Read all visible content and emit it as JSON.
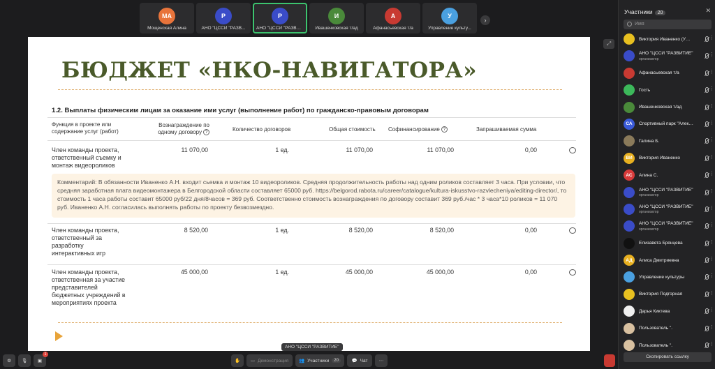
{
  "strip": {
    "tiles": [
      {
        "name": "Мощенская Алина",
        "avatar": "МА",
        "color": "#e8743b",
        "active": false
      },
      {
        "name": "АНО \"ЦССИ \"РАЗВ...",
        "avatar": "Р",
        "color": "#3a4cc8",
        "active": false
      },
      {
        "name": "АНО \"ЦССИ \"РАЗВИТ...",
        "avatar": "Р",
        "color": "#3a4cc8",
        "active": true
      },
      {
        "name": "Ивашенковская т/ад",
        "avatar": "И",
        "color": "#4a8a3a",
        "active": false
      },
      {
        "name": "Афанасьевская т/а",
        "avatar": "А",
        "color": "#c83a32",
        "active": false
      },
      {
        "name": "Управление культу...",
        "avatar": "У",
        "color": "#4aa0e0",
        "active": false
      }
    ]
  },
  "slide": {
    "title": "БЮДЖЕТ «НКО-НАВИГАТОРА»",
    "section": "1.2. Выплаты физическим лицам за оказание ими услуг (выполнение работ) по гражданско-правовым договорам",
    "headers": {
      "function": "Функция в проекте или содержание услуг (работ)",
      "fee": "Вознаграждение по одному договору",
      "count": "Количество договоров",
      "total": "Общая стоимость",
      "cofin": "Софинансирование",
      "requested": "Запрашиваемая сумма"
    },
    "rows": [
      {
        "function": "Член команды проекта, ответственный съемку и монтаж видеороликов",
        "fee": "11 070,00",
        "count": "1 ед.",
        "total": "11 070,00",
        "cofin": "11 070,00",
        "requested": "0,00"
      },
      {
        "function": "Член команды проекта, ответственный за разработку интерактивных игр",
        "fee": "8 520,00",
        "count": "1 ед.",
        "total": "8 520,00",
        "cofin": "8 520,00",
        "requested": "0,00"
      },
      {
        "function": "Член команды проекта, ответственная за участие представителей бюджетных учреждений в мероприятиях проекта",
        "fee": "45 000,00",
        "count": "1 ед.",
        "total": "45 000,00",
        "cofin": "45 000,00",
        "requested": "0,00"
      }
    ],
    "comment": "Комментарий: В обязанности Иваненко А.Н. входит сьемка и монтаж 10 видеороликов. Средняя продолжительность работы над одним роликов составляет 3 часа. При условии, что средняя заработная плата видеомонтажера в Белгородской области составляет 65000 руб. https://belgorod.rabota.ru/career/catalogue/kultura-iskusstvo-razvlecheniya/editing-director/, то стоимость 1 часа работы составит 65000 руб/22 дня/8часов = 369 руб. Соответственно стоимость вознаграждения по договору составит 369 руб./час * 3 часа*10 роликов = 11 070 руб. Иваненко А.Н. согласилась выполнять работы по проекту безвозмездно."
  },
  "speaker_tag": "АНО \"ЦССИ \"РАЗВИТИЕ\"",
  "panel": {
    "title": "Участники",
    "count": "20",
    "search_placeholder": "Имя",
    "copy_link": "Скопировать ссылку",
    "participants": [
      {
        "name": "Виктория Иваненко (УФКС...",
        "role": "",
        "avatar": "",
        "color": "#e8c020"
      },
      {
        "name": "АНО \"ЦССИ \"РАЗВИТИЕ\"",
        "role": "организатор",
        "avatar": "",
        "color": "#3a4cc8"
      },
      {
        "name": "Афанасьевская т/а",
        "role": "",
        "avatar": "",
        "color": "#c83a32"
      },
      {
        "name": "Гость",
        "role": "",
        "avatar": "",
        "color": "#3cb85a"
      },
      {
        "name": "Ивашенковская т/ад",
        "role": "",
        "avatar": "",
        "color": "#4a8a3a"
      },
      {
        "name": "Спортивный парк \"Алексее...",
        "role": "",
        "avatar": "СА",
        "color": "#3a5ad8"
      },
      {
        "name": "Галина Б.",
        "role": "",
        "avatar": "",
        "color": "#8a7a5a"
      },
      {
        "name": "Виктория Иваненко",
        "role": "",
        "avatar": "ВИ",
        "color": "#e8b020"
      },
      {
        "name": "Алина С.",
        "role": "",
        "avatar": "АС",
        "color": "#d83a3a"
      },
      {
        "name": "АНО \"ЦССИ \"РАЗВИТИЕ\"",
        "role": "организатор",
        "avatar": "",
        "color": "#3a4cc8"
      },
      {
        "name": "АНО \"ЦССИ \"РАЗВИТИЕ\"",
        "role": "организатор",
        "avatar": "",
        "color": "#3a4cc8"
      },
      {
        "name": "АНО \"ЦССИ \"РАЗВИТИЕ\"",
        "role": "организатор",
        "avatar": "",
        "color": "#3a4cc8"
      },
      {
        "name": "Елизавета Брянцева",
        "role": "",
        "avatar": "",
        "color": "#111111"
      },
      {
        "name": "Алиса Дмитриевна",
        "role": "",
        "avatar": "АД",
        "color": "#e8b020"
      },
      {
        "name": "Управление культуры",
        "role": "",
        "avatar": "",
        "color": "#4aa0e0"
      },
      {
        "name": "Виктория Подгорная",
        "role": "",
        "avatar": "",
        "color": "#e8c020"
      },
      {
        "name": "Дарья Киктева",
        "role": "",
        "avatar": "",
        "color": "#f0f0f0"
      },
      {
        "name": "Пользователь \".",
        "role": "",
        "avatar": "",
        "color": "#d8c0a0"
      },
      {
        "name": "Пользователь \".",
        "role": "",
        "avatar": "",
        "color": "#d8c0a0"
      }
    ]
  },
  "bottom": {
    "demo_label": "Демонстрация",
    "participants_label": "Участники",
    "participants_count": "20",
    "chat_label": "Чат",
    "notify_count": "1"
  }
}
